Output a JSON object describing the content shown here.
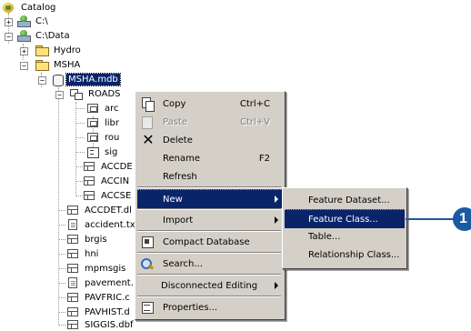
{
  "tree": {
    "catalog": "Catalog",
    "c_root": "C:\\",
    "c_data": "C:\\Data",
    "hydro": "Hydro",
    "msha": "MSHA",
    "msha_mdb": "MSHA.mdb",
    "roads": "ROADS",
    "roads_children": [
      "arc",
      "libr",
      "rou",
      "sig"
    ],
    "accde": "ACCDE",
    "accin": "ACCIN",
    "accse": "ACCSE",
    "files": [
      "ACCDET.dl",
      "accident.tx",
      "brgis",
      "hni",
      "mpmsgis",
      "pavement.",
      "PAVFRIC.c",
      "PAVHIST.d",
      "SIGGIS.dbf"
    ]
  },
  "context_menu": {
    "copy": "Copy",
    "copy_key": "Ctrl+C",
    "paste": "Paste",
    "paste_key": "Ctrl+V",
    "delete": "Delete",
    "rename": "Rename",
    "rename_key": "F2",
    "refresh": "Refresh",
    "new": "New",
    "import": "Import",
    "compact": "Compact Database",
    "search": "Search...",
    "disconnected": "Disconnected Editing",
    "properties": "Properties..."
  },
  "submenu": {
    "feature_dataset": "Feature Dataset...",
    "feature_class": "Feature Class...",
    "table": "Table...",
    "relationship_class": "Relationship Class..."
  },
  "callout": {
    "number": "1"
  },
  "colors": {
    "highlight": "#0a246a",
    "menu_bg": "#d4d0c8",
    "callout": "#1a5aa0"
  }
}
